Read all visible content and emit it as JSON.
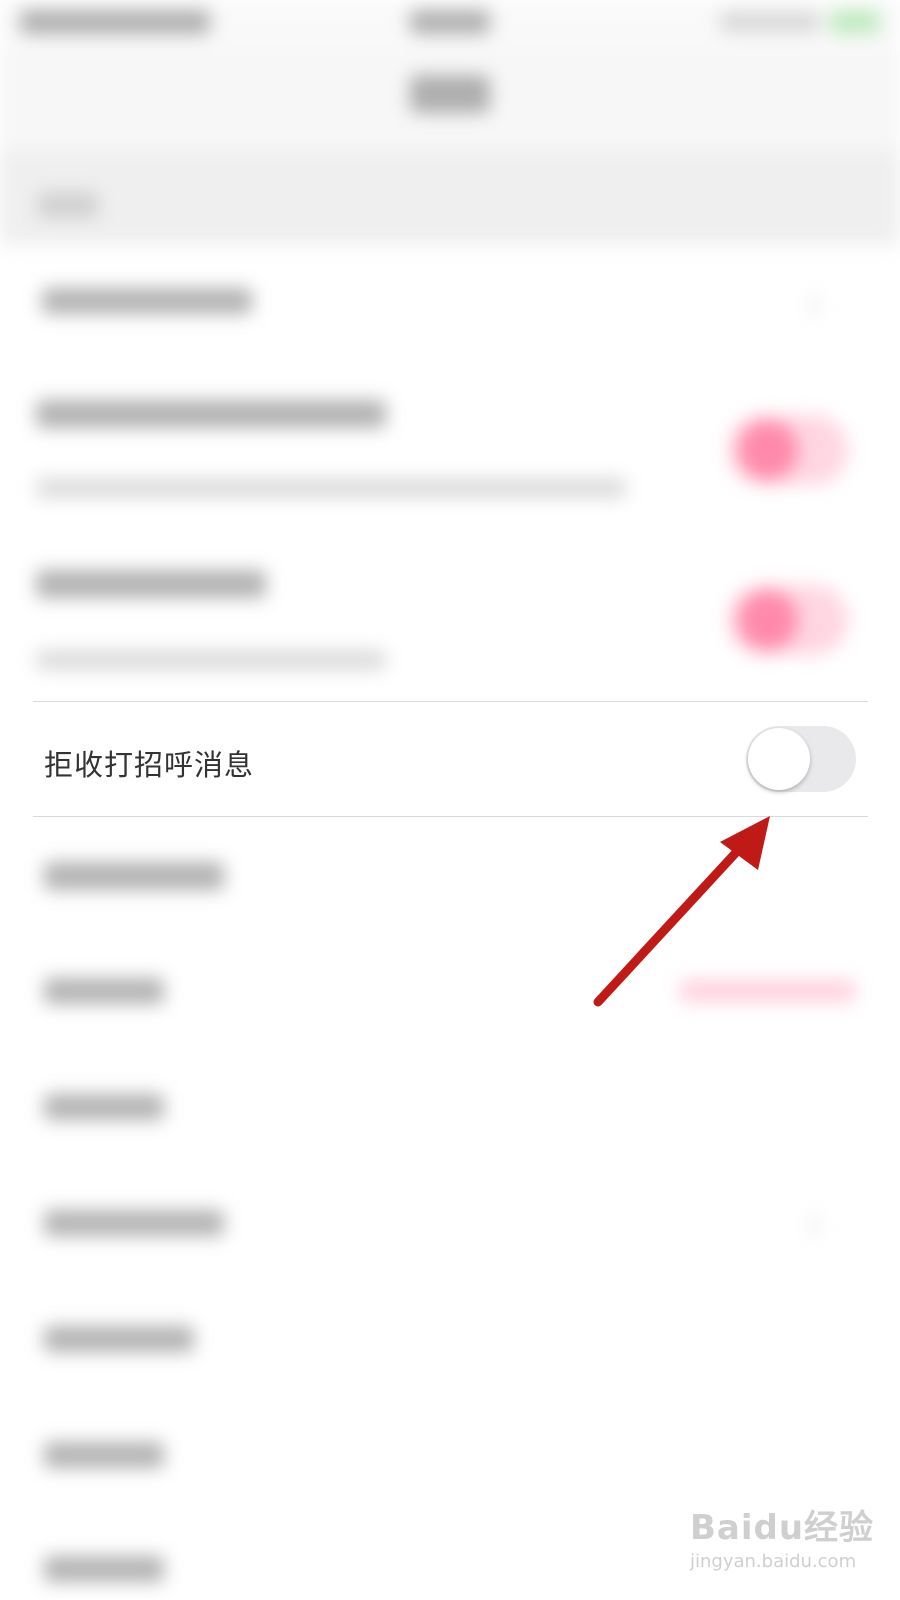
{
  "setting": {
    "label": "拒收打招呼消息",
    "enabled": false
  },
  "colors": {
    "arrow": "#c01a16",
    "toggle_off_track": "#e9e9ec",
    "accent_pink": "#ff8aab"
  },
  "watermark": {
    "logo": "Baidu经验",
    "url": "jingyan.baidu.com"
  }
}
